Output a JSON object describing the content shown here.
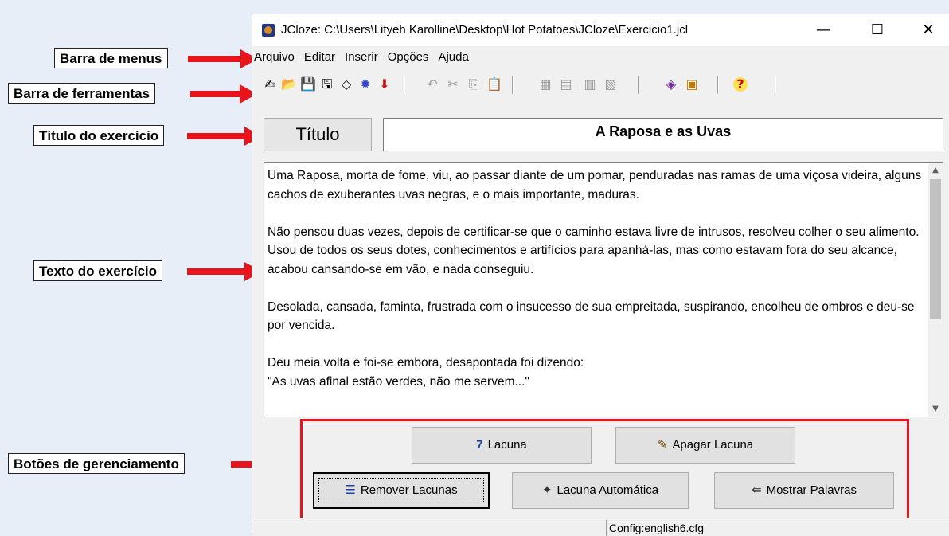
{
  "annotations": {
    "menu_bar": "Barra de menus",
    "toolbar": "Barra de ferramentas",
    "exercise_title": "Título do exercício",
    "exercise_text": "Texto do exercício",
    "management_buttons": "Botões de gerenciamento"
  },
  "window": {
    "title": "JCloze: C:\\Users\\Lityeh Karolline\\Desktop\\Hot Potatoes\\JCloze\\Exercicio1.jcl",
    "minimize": "—",
    "maximize": "☐",
    "close": "✕"
  },
  "menu": [
    "Arquivo",
    "Editar",
    "Inserir",
    "Opções",
    "Ajuda"
  ],
  "toolbar": {
    "icons": [
      "new-file-icon",
      "open-folder-icon",
      "save-icon",
      "save-as-icon",
      "erase-icon",
      "puzzle-icon",
      "arrow-down-icon",
      "undo-icon",
      "cut-icon",
      "copy-icon",
      "paste-icon",
      "export-web-icon",
      "export-print-icon",
      "export-other-icon",
      "export-extra-icon",
      "palette-icon",
      "config-icon",
      "help-icon"
    ],
    "glyphs": [
      "✍",
      "📂",
      "💾",
      "🖫",
      "◇",
      "✹",
      "⬇",
      "↶",
      "✂",
      "⎘",
      "📋",
      "▦",
      "▤",
      "▥",
      "▧",
      "◈",
      "▣",
      "?"
    ]
  },
  "title_button": "Título",
  "exercise_title": "A Raposa e as Uvas",
  "text_paragraphs": [
    "Uma Raposa, morta de fome, viu, ao passar diante de um pomar, penduradas nas ramas de uma viçosa videira, alguns cachos de exuberantes uvas negras, e o mais importante, maduras.",
    "Não pensou duas vezes, depois de certificar-se que o caminho estava livre de intrusos, resolveu colher o seu alimento.",
    "Usou de todos os seus dotes, conhecimentos e artifícios para apanhá-las, mas como estavam fora do seu alcance, acabou cansando-se em vão, e nada conseguiu.",
    "Desolada, cansada, faminta, frustrada com o insucesso de sua empreitada, suspirando, encolheu de ombros e deu-se por vencida.",
    "Deu meia volta e foi-se embora, desapontada foi dizendo:",
    "\"As uvas afinal estão verdes, não me servem...\""
  ],
  "buttons": {
    "gap": "Lacuna",
    "delete_gap": "Apagar Lacuna",
    "remove_gaps": "Remover Lacunas",
    "auto_gap": "Lacuna Automática",
    "show_words": "Mostrar Palavras"
  },
  "status": "Config:english6.cfg",
  "colors": {
    "annotation_arrow": "#e8141c",
    "highlight_box": "#e8141c"
  }
}
